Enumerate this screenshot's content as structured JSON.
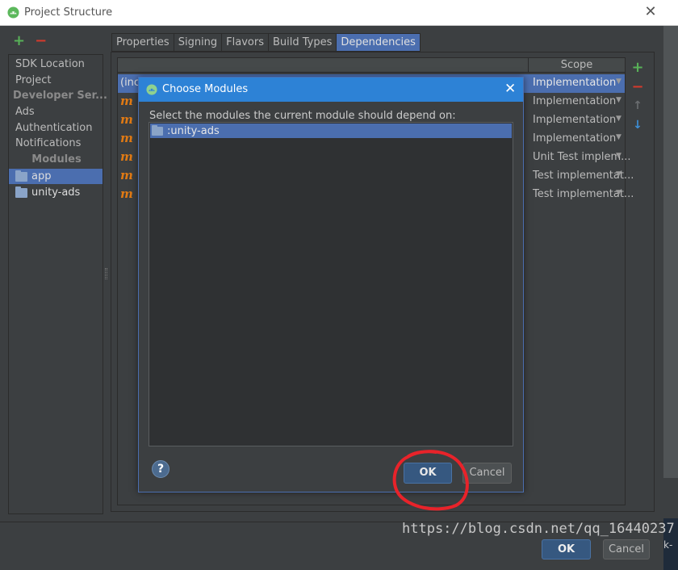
{
  "window": {
    "title": "Project Structure",
    "close_glyph": "✕"
  },
  "sidebar": {
    "add_glyph": "+",
    "remove_glyph": "−",
    "items": [
      {
        "label": "SDK Location"
      },
      {
        "label": "Project"
      },
      {
        "label": "Developer Ser..."
      },
      {
        "label": "Ads"
      },
      {
        "label": "Authentication"
      },
      {
        "label": "Notifications"
      },
      {
        "label": "Modules"
      }
    ],
    "modules": [
      {
        "label": "app",
        "selected": true
      },
      {
        "label": "unity-ads",
        "selected": false
      }
    ]
  },
  "tabs": [
    {
      "label": "Properties"
    },
    {
      "label": "Signing"
    },
    {
      "label": "Flavors"
    },
    {
      "label": "Build Types"
    },
    {
      "label": "Dependencies",
      "active": true
    }
  ],
  "dependencies": {
    "scope_header": "Scope",
    "first_row_text": "(incl",
    "module_glyph": "m",
    "rows": [
      {
        "name_fragment": "(incl",
        "scope": "Implementation",
        "selected": true
      },
      {
        "name_fragment": "c",
        "scope": "Implementation"
      },
      {
        "name_fragment": "c",
        "scope": "Implementation"
      },
      {
        "name_fragment": "c",
        "scope": "Implementation"
      },
      {
        "name_fragment": "j",
        "scope": "Unit Test implem..."
      },
      {
        "name_fragment": "c",
        "scope": "Test implementat..."
      },
      {
        "name_fragment": "c",
        "scope": "Test implementat..."
      }
    ],
    "tools": {
      "add": "+",
      "remove": "−",
      "up": "↑",
      "down": "↓"
    }
  },
  "modal": {
    "title": "Choose Modules",
    "close_glyph": "✕",
    "prompt": "Select the modules the current module should depend on:",
    "modules": [
      ":unity-ads"
    ],
    "help_glyph": "?",
    "ok_label": "OK",
    "cancel_label": "Cancel"
  },
  "footer": {
    "ok_label": "OK",
    "cancel_label": "Cancel",
    "bg_fragment": "k-de"
  },
  "watermark": "https://blog.csdn.net/qq_16440237",
  "colors": {
    "accent": "#4b6eaf",
    "modal_title": "#2d82d6",
    "module_m": "#e07a14",
    "annotation": "#e8232a"
  },
  "icons": [
    "android-icon",
    "close-icon",
    "plus-icon",
    "minus-icon",
    "folder-icon",
    "module-folder-icon",
    "arrow-up-icon",
    "arrow-down-icon",
    "help-icon",
    "dropdown-arrow-icon"
  ]
}
